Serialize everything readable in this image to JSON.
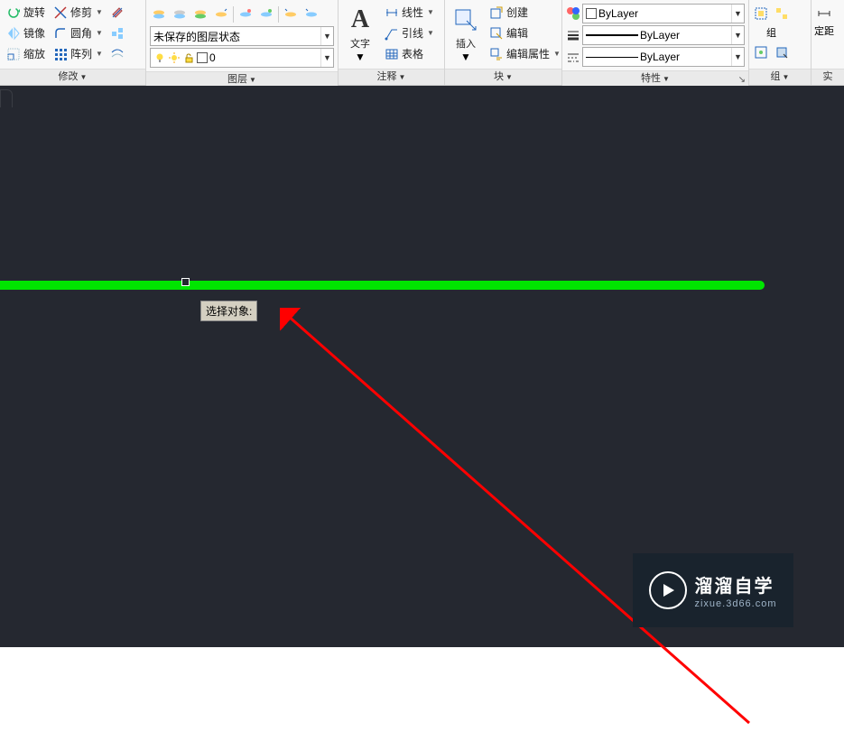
{
  "ribbon": {
    "modify": {
      "title": "修改",
      "rotate": "旋转",
      "trim": "修剪",
      "mirror": "镜像",
      "fillet": "圆角",
      "scale": "缩放",
      "array": "阵列"
    },
    "layer": {
      "title": "图层",
      "layer_state": "未保存的图层状态",
      "layer0": "0"
    },
    "annotate": {
      "title": "注释",
      "text": "文字",
      "linear": "线性",
      "leader": "引线",
      "table": "表格"
    },
    "block": {
      "title": "块",
      "insert": "插入",
      "create": "创建",
      "edit": "编辑",
      "editattr": "编辑属性"
    },
    "properties": {
      "title": "特性",
      "bylayer": "ByLayer"
    },
    "group": {
      "title": "组",
      "group": "组"
    },
    "utilities": {
      "title": "实",
      "dist": "定距"
    }
  },
  "canvas": {
    "tooltip": "选择对象:"
  },
  "watermark": {
    "line1": "溜溜自学",
    "line2": "zixue.3d66.com"
  }
}
